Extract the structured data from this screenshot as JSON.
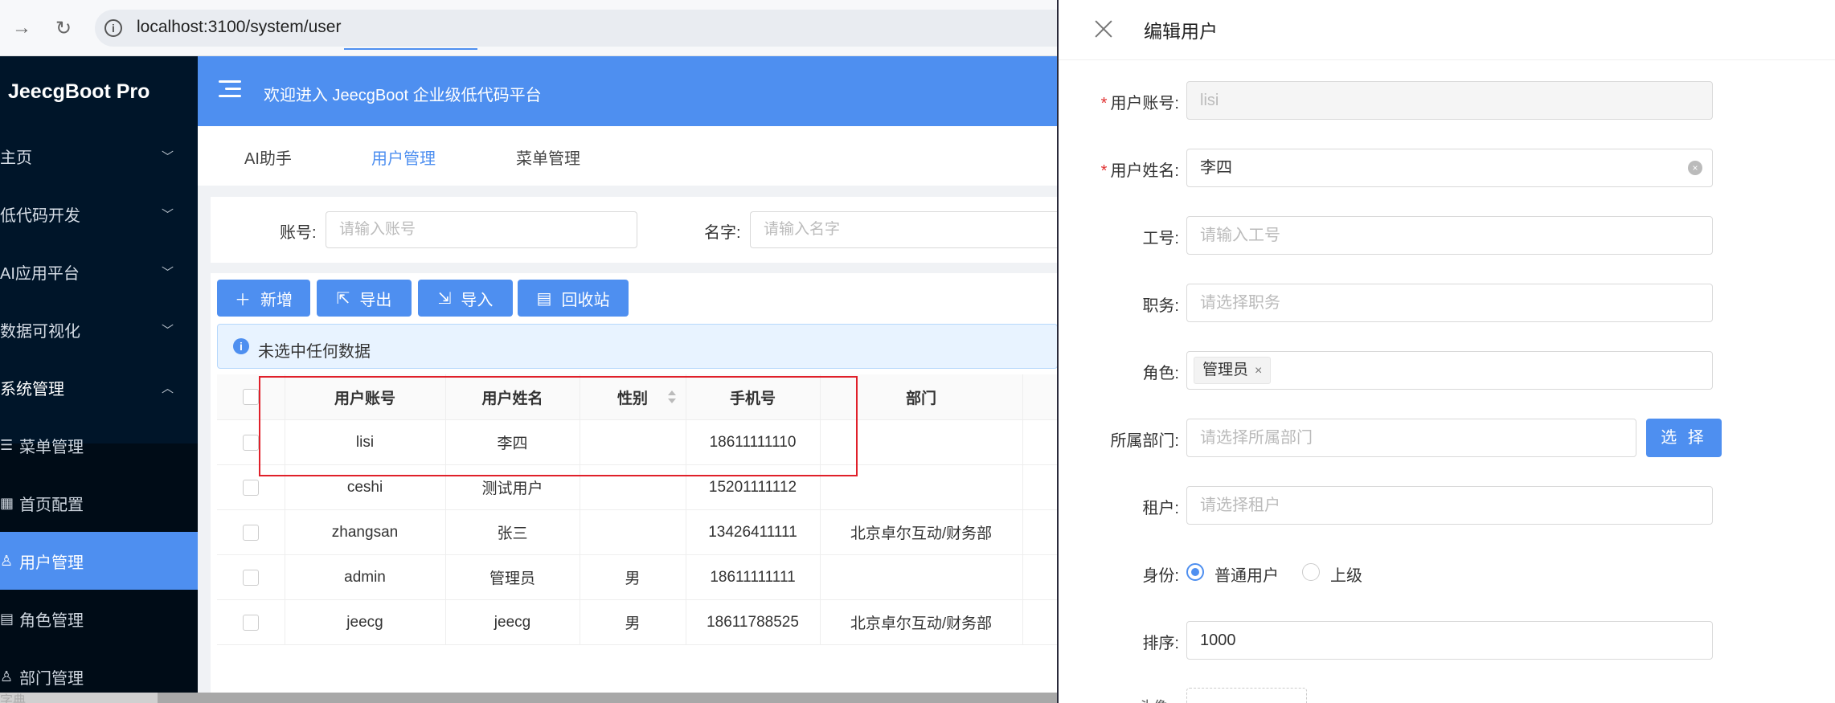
{
  "browser": {
    "url": "localhost:3100/system/user"
  },
  "app": {
    "logo": "JeecgBoot Pro",
    "welcome": "欢迎进入 JeecgBoot 企业级低代码平台"
  },
  "sidebar": {
    "items": [
      {
        "label": "主页"
      },
      {
        "label": "低代码开发"
      },
      {
        "label": "AI应用平台"
      },
      {
        "label": "数据可视化"
      },
      {
        "label": "系统管理"
      }
    ],
    "subitems": [
      {
        "label": "菜单管理"
      },
      {
        "label": "首页配置"
      },
      {
        "label": "用户管理"
      },
      {
        "label": "角色管理"
      },
      {
        "label": "部门管理"
      }
    ],
    "cutoff": "字典"
  },
  "tabs": [
    {
      "label": "AI助手"
    },
    {
      "label": "用户管理"
    },
    {
      "label": "菜单管理"
    }
  ],
  "search": {
    "account_label": "账号:",
    "account_placeholder": "请输入账号",
    "name_label": "名字:",
    "name_placeholder": "请输入名字"
  },
  "toolbar": {
    "add": "新增",
    "export": "导出",
    "import": "导入",
    "recycle": "回收站"
  },
  "alert": "未选中任何数据",
  "table": {
    "headers": {
      "account": "用户账号",
      "name": "用户姓名",
      "gender": "性别",
      "phone": "手机号",
      "dept": "部门"
    },
    "rows": [
      {
        "account": "lisi",
        "name": "李四",
        "gender": "",
        "phone": "18611111110",
        "dept": ""
      },
      {
        "account": "ceshi",
        "name": "测试用户",
        "gender": "",
        "phone": "15201111112",
        "dept": ""
      },
      {
        "account": "zhangsan",
        "name": "张三",
        "gender": "",
        "phone": "13426411111",
        "dept": "北京卓尔互动/财务部"
      },
      {
        "account": "admin",
        "name": "管理员",
        "gender": "男",
        "phone": "18611111111",
        "dept": ""
      },
      {
        "account": "jeecg",
        "name": "jeecg",
        "gender": "男",
        "phone": "18611788525",
        "dept": "北京卓尔互动/财务部"
      }
    ]
  },
  "drawer": {
    "title": "编辑用户",
    "fields": {
      "account_label": "用户账号:",
      "account_value": "lisi",
      "realname_label": "用户姓名:",
      "realname_value": "李四",
      "workno_label": "工号:",
      "workno_placeholder": "请输入工号",
      "post_label": "职务:",
      "post_placeholder": "请选择职务",
      "role_label": "角色:",
      "role_tag": "管理员",
      "dept_label": "所属部门:",
      "dept_placeholder": "请选择所属部门",
      "dept_button": "选 择",
      "tenant_label": "租户:",
      "tenant_placeholder": "请选择租户",
      "identity_label": "身份:",
      "identity_options": [
        "普通用户",
        "上级"
      ],
      "identity_selected": "普通用户",
      "order_label": "排序:",
      "order_value": "1000",
      "avatar_label": "头像"
    }
  }
}
